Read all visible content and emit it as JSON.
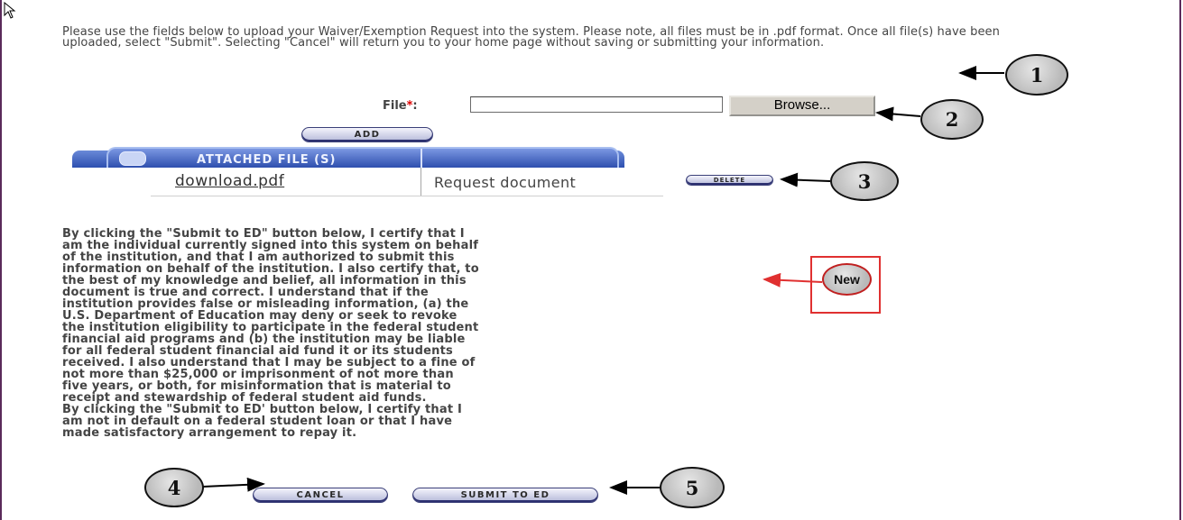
{
  "intro_text": "Please use the fields below to upload your Waiver/Exemption Request into the system. Please note, all files must be in .pdf format. Once all file(s) have been uploaded, select \"Submit\". Selecting \"Cancel\" will return you to your home page without saving or submitting your information.",
  "upload": {
    "file_label": "File",
    "required_marker": "*",
    "file_label_suffix": ":",
    "file_value": "",
    "browse_label": "Browse...",
    "add_label": "ADD"
  },
  "attached": {
    "header": "ATTACHED FILE (S)",
    "files": [
      {
        "name": "download.pdf",
        "description": "Request document",
        "delete_label": "DELETE"
      }
    ]
  },
  "certification_text": "By clicking the \"Submit to ED\" button below, I certify that I\nam the individual currently signed into this system on behalf\nof the institution, and that I am authorized to submit this\ninformation on behalf of the institution. I also certify that, to\nthe best of my knowledge and belief, all information in this\ndocument is true and correct. I understand that if the\ninstitution provides false or misleading information, (a) the\nU.S. Department of Education may deny or seek to revoke\nthe institution eligibility to participate in the federal student\nfinancial aid programs and (b) the institution may be liable\nfor all federal student financial aid fund it or its students\nreceived. I also understand that I may be subject to a fine of\nnot more than $25,000 or imprisonment of not more than\nfive years, or both, for misinformation that is material to\nreceipt and stewardship of federal student aid funds.\nBy clicking the \"Submit to ED' button below, I certify that I\nam not in default on a federal student loan or that I have\nmade satisfactory arrangement to repay it.",
  "buttons": {
    "cancel": "CANCEL",
    "submit": "SUBMIT TO ED"
  },
  "callouts": {
    "c1": "1",
    "c2": "2",
    "c3": "3",
    "c4": "4",
    "c5": "5",
    "new": "New"
  },
  "colors": {
    "frame": "#5a2a5a",
    "header_blue": "#2d4fb0",
    "new_red": "#e03030"
  }
}
